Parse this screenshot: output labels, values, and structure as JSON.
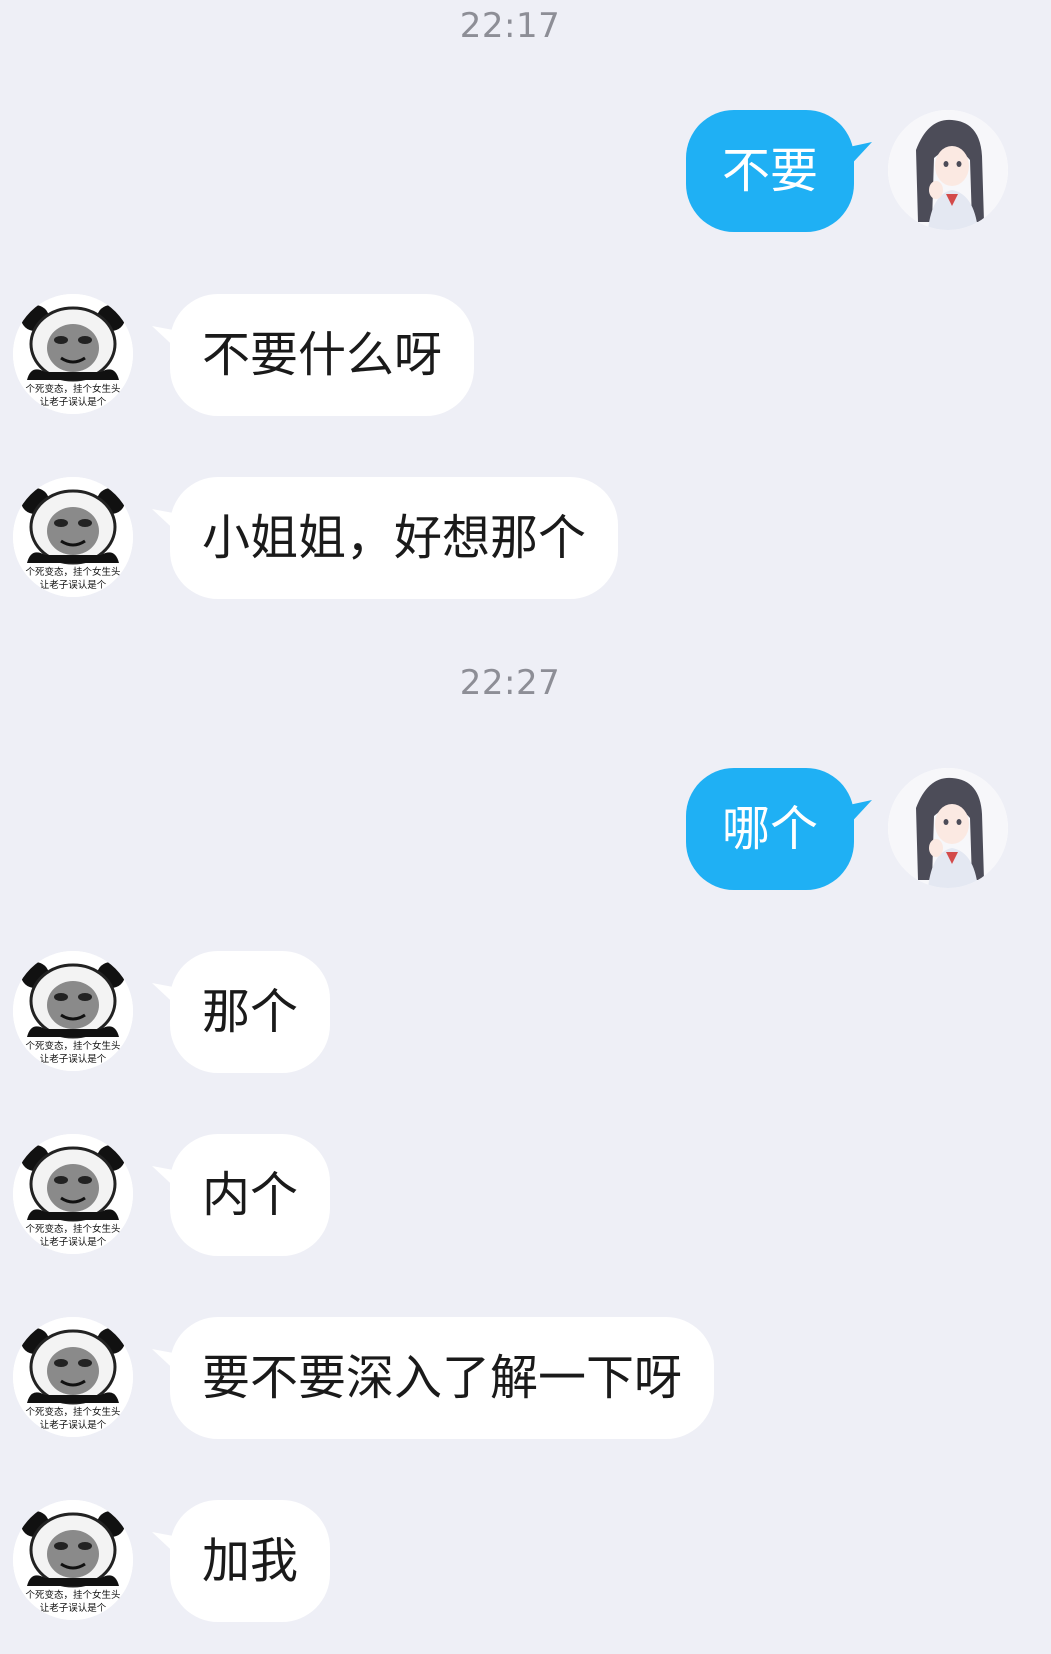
{
  "chat": {
    "timestamps": [
      "22:17",
      "22:27"
    ],
    "messages": [
      {
        "side": "out",
        "text": "不要"
      },
      {
        "side": "in",
        "text": "不要什么呀"
      },
      {
        "side": "in",
        "text": "小姐姐，好想那个"
      },
      {
        "side": "out",
        "text": "哪个"
      },
      {
        "side": "in",
        "text": "那个"
      },
      {
        "side": "in",
        "text": "内个"
      },
      {
        "side": "in",
        "text": "要不要深入了解一下呀"
      },
      {
        "side": "in",
        "text": "加我"
      }
    ],
    "incoming_avatar": {
      "icon": "panda-meme-avatar-icon",
      "caption_line1": "个死变态，挂个女生头",
      "caption_line2": "让老子误认是个"
    },
    "outgoing_avatar": {
      "icon": "anime-girl-avatar-icon"
    },
    "colors": {
      "background": "#eeeff6",
      "outgoing_bubble": "#1fb0f4",
      "incoming_bubble": "#ffffff",
      "timestamp": "#8d8e96"
    }
  }
}
